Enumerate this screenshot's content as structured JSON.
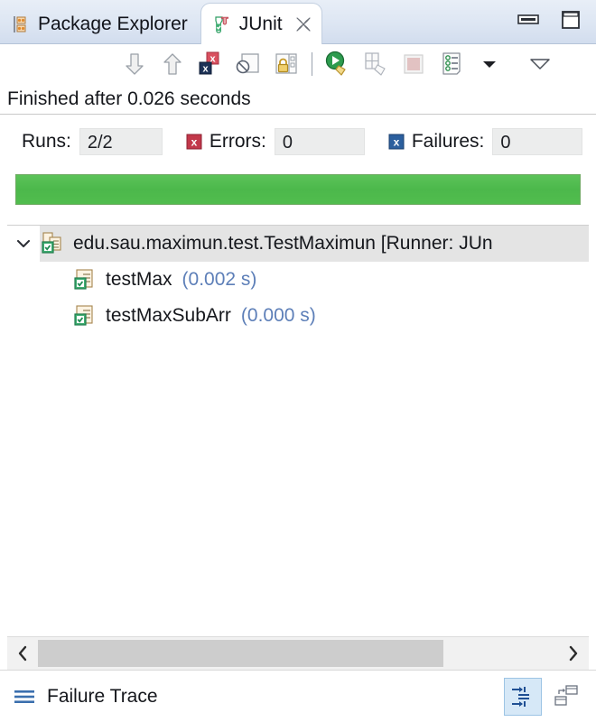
{
  "window": {
    "minimize_icon": "minimize-icon",
    "maximize_icon": "maximize-icon"
  },
  "tabs": [
    {
      "label": "Package Explorer",
      "icon": "package-explorer-icon",
      "active": false,
      "closeable": false
    },
    {
      "label": "JUnit",
      "icon": "junit-icon",
      "active": true,
      "closeable": true,
      "close_icon": "close-icon"
    }
  ],
  "toolbar": {
    "buttons": [
      {
        "name": "next-failed-test-button",
        "icon": "arrow-down-icon",
        "tooltip": "Next Failed Test"
      },
      {
        "name": "previous-failed-test-button",
        "icon": "arrow-up-icon",
        "tooltip": "Previous Failed Test"
      },
      {
        "name": "show-failures-only-button",
        "icon": "failures-only-icon",
        "tooltip": "Show Failures Only"
      },
      {
        "name": "show-ignored-button",
        "icon": "ignored-tests-icon",
        "tooltip": "Show Ignored Tests"
      },
      {
        "name": "scroll-lock-button",
        "icon": "lock-icon",
        "tooltip": "Scroll Lock"
      },
      {
        "name": "rerun-test-button",
        "icon": "rerun-icon",
        "tooltip": "Rerun Test"
      },
      {
        "name": "rerun-failed-first-button",
        "icon": "rerun-failed-icon",
        "tooltip": "Rerun Test - Failures First"
      },
      {
        "name": "stop-button",
        "icon": "stop-icon",
        "tooltip": "Stop JUnit Test Run"
      },
      {
        "name": "test-run-history-button",
        "icon": "history-icon",
        "tooltip": "Test Run History"
      },
      {
        "name": "history-dropdown-button",
        "icon": "chevron-down-icon",
        "tooltip": "Test Run History Menu"
      },
      {
        "name": "view-menu-button",
        "icon": "view-menu-icon",
        "tooltip": "View Menu"
      }
    ]
  },
  "status": {
    "text": "Finished after 0.026 seconds"
  },
  "counters": {
    "runs": {
      "label": "Runs:",
      "value": "2/2"
    },
    "errors": {
      "label": "Errors:",
      "value": "0",
      "icon": "error-x-icon",
      "icon_color": "#c2384a"
    },
    "failures": {
      "label": "Failures:",
      "value": "0",
      "icon": "failure-x-icon",
      "icon_color": "#2b5f9e"
    }
  },
  "progress": {
    "percent": 100,
    "color": "#4cb84b",
    "state": "passed"
  },
  "tree": {
    "rows": [
      {
        "name": "test-suite-row",
        "label": "edu.sau.maximun.test.TestMaximun [Runner: JUn",
        "duration": "",
        "icon": "test-suite-pass-icon",
        "twisty": "chevron-down-icon",
        "level": 0,
        "selected": true,
        "expanded": true
      },
      {
        "name": "test-case-row",
        "label": "testMax",
        "duration": "(0.002 s)",
        "icon": "test-case-pass-icon",
        "twisty": "",
        "level": 1,
        "selected": false,
        "expanded": false
      },
      {
        "name": "test-case-row",
        "label": "testMaxSubArr",
        "duration": "(0.000 s)",
        "icon": "test-case-pass-icon",
        "twisty": "",
        "level": 1,
        "selected": false,
        "expanded": false
      }
    ]
  },
  "scrollbar": {
    "left_arrow": "chevron-left-icon",
    "right_arrow": "chevron-right-icon",
    "thumb_percent": 78
  },
  "footer": {
    "icon": "failure-trace-icon",
    "label": "Failure Trace",
    "buttons": [
      {
        "name": "compare-results-button",
        "icon": "compare-result-icon",
        "active": true
      },
      {
        "name": "show-stack-trace-button",
        "icon": "stack-trace-icon",
        "active": false
      }
    ]
  }
}
